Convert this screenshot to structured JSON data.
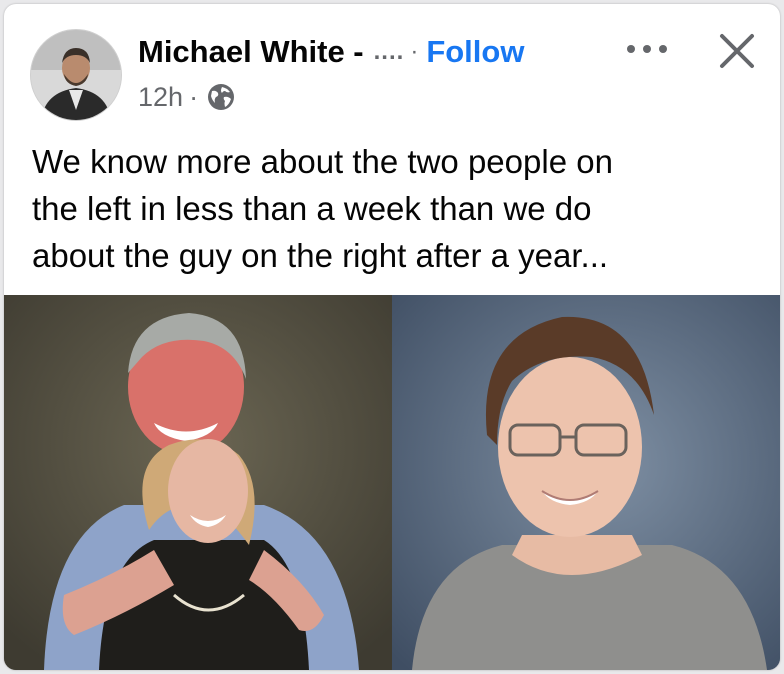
{
  "post": {
    "author": "Michael White -",
    "author_truncation": "....",
    "separator": "·",
    "follow_label": "Follow",
    "timestamp": "12h",
    "meta_separator": "·",
    "audience_icon": "globe-icon",
    "more_icon": "more-options-icon",
    "close_icon": "close-icon",
    "text_lines": [
      "We know more about the two people on",
      "the left in less than a week than we do",
      "about the guy on the right after a year..."
    ]
  },
  "colors": {
    "follow": "#1877f2",
    "text": "#050505",
    "secondary_text": "#65676b",
    "card_background": "#ffffff"
  }
}
